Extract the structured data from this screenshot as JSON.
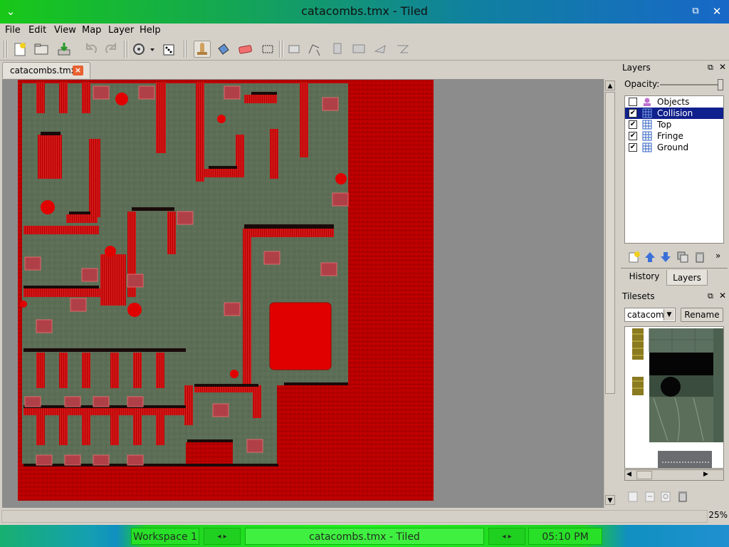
{
  "window": {
    "title": "catacombs.tmx - Tiled"
  },
  "menu": {
    "file": "File",
    "edit": "Edit",
    "view": "View",
    "map": "Map",
    "layer": "Layer",
    "help": "Help"
  },
  "tabs": {
    "active": "catacombs.tmx"
  },
  "layers_panel": {
    "title": "Layers",
    "opacity_label": "Opacity:",
    "opacity": 1.0,
    "items": [
      {
        "name": "Objects",
        "checked": false
      },
      {
        "name": "Collision",
        "checked": true
      },
      {
        "name": "Top",
        "checked": true
      },
      {
        "name": "Fringe",
        "checked": true
      },
      {
        "name": "Ground",
        "checked": true
      }
    ]
  },
  "bottom_tabs": {
    "history": "History",
    "layers": "Layers"
  },
  "tilesets_panel": {
    "title": "Tilesets",
    "selected": "catacomb",
    "rename": "Rename"
  },
  "status": {
    "zoom": "25%"
  },
  "taskbar": {
    "workspace": "Workspace 1",
    "window": "catacombs.tmx - Tiled",
    "clock": "05:10 PM"
  },
  "colors": {
    "wall": "#c80000",
    "floor": "#5a6e54",
    "selection": "#10208c"
  },
  "icons": [
    "app-menu-icon",
    "restore-icon",
    "close-icon",
    "new-map-icon",
    "open-icon",
    "save-icon",
    "undo-icon",
    "redo-icon",
    "random-icon",
    "dice-icon",
    "stamp-icon",
    "bucket-icon",
    "eraser-icon",
    "select-icon"
  ]
}
